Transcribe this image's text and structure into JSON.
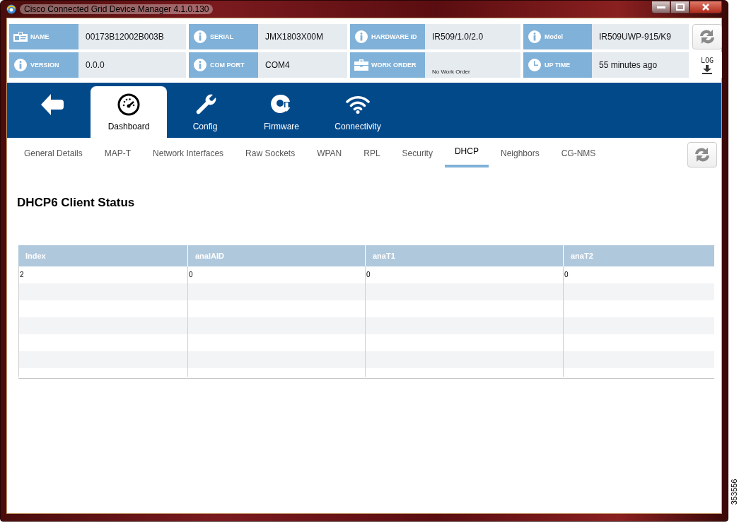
{
  "window": {
    "title": "Cisco Connected Grid Device Manager 4.1.0.130"
  },
  "info_fields": [
    {
      "kind": "id-card",
      "label": "NAME",
      "value": "00173B12002B003B"
    },
    {
      "kind": "info",
      "label": "SERIAL",
      "value": "JMX1803X00M"
    },
    {
      "kind": "info",
      "label": "HARDWARE ID",
      "value": "IR509/1.0/2.0"
    },
    {
      "kind": "info",
      "label": "Model",
      "value": "IR509UWP-915/K9"
    },
    {
      "kind": "info",
      "label": "VERSION",
      "value": "0.0.0"
    },
    {
      "kind": "info",
      "label": "COM PORT",
      "value": "COM4"
    },
    {
      "kind": "briefcase",
      "label": "WORK ORDER",
      "placeholder": "No Work Order"
    },
    {
      "kind": "clock",
      "label": "UP TIME",
      "value": "55 minutes ago"
    }
  ],
  "log_button": {
    "label": "LOG"
  },
  "nav_tabs": [
    {
      "kind": "back",
      "selected": false
    },
    {
      "kind": "gauge",
      "label": "Dashboard",
      "selected": true
    },
    {
      "kind": "wrench",
      "label": "Config",
      "selected": false
    },
    {
      "kind": "disc",
      "label": "Firmware",
      "selected": false
    },
    {
      "kind": "wifi",
      "label": "Connectivity",
      "selected": false
    }
  ],
  "sub_tabs": [
    {
      "label": "General Details",
      "selected": false
    },
    {
      "label": "MAP-T",
      "selected": false
    },
    {
      "label": "Network Interfaces",
      "selected": false
    },
    {
      "label": "Raw Sockets",
      "selected": false
    },
    {
      "label": "WPAN",
      "selected": false
    },
    {
      "label": "RPL",
      "selected": false
    },
    {
      "label": "Security",
      "selected": false
    },
    {
      "label": "DHCP",
      "selected": true
    },
    {
      "label": "Neighbors",
      "selected": false
    },
    {
      "label": "CG-NMS",
      "selected": false
    }
  ],
  "section_title": "DHCP6 Client Status",
  "table": {
    "columns": [
      "Index",
      "analAID",
      "anaT1",
      "anaT2"
    ],
    "rows": [
      [
        "2",
        "0",
        "0",
        "0"
      ]
    ]
  },
  "figure_number": "353556"
}
